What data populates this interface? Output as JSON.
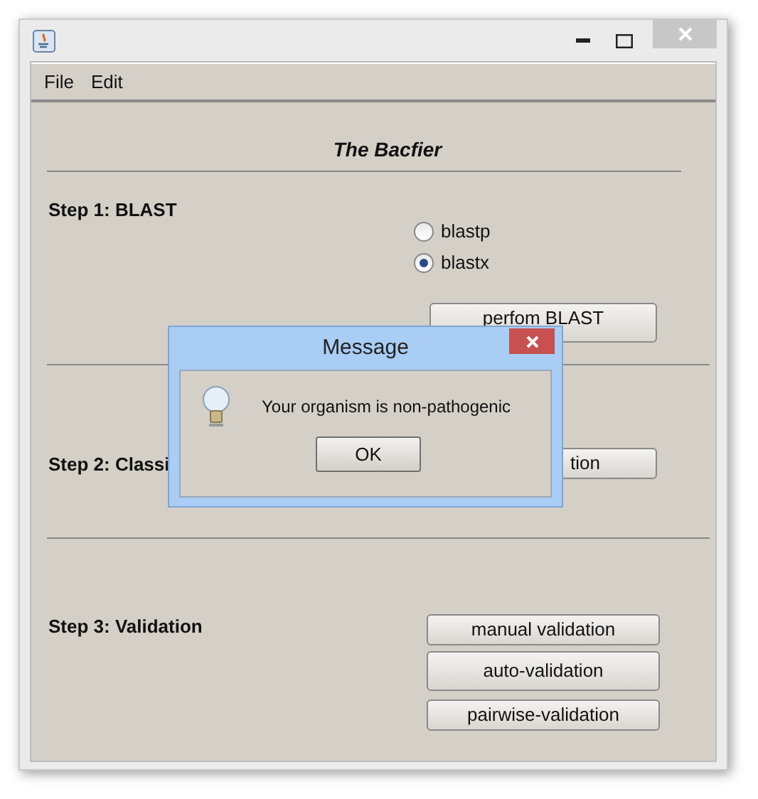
{
  "menu": [
    "File",
    "Edit"
  ],
  "title": "The Bacfier",
  "steps": [
    {
      "label": "Step 1: BLAST",
      "options": [
        {
          "label": "blastp",
          "selected": false
        },
        {
          "label": "blastx",
          "selected": true
        }
      ],
      "buttons": [
        "perfom BLAST"
      ]
    },
    {
      "label": "Step 2: Classi",
      "buttons": [
        "tion"
      ]
    },
    {
      "label": "Step 3: Validation",
      "buttons": [
        "manual validation",
        "auto-validation",
        "pairwise-validation"
      ]
    }
  ],
  "dialog": {
    "title": "Message",
    "message": "Your organism is non-pathogenic",
    "button": "OK"
  }
}
